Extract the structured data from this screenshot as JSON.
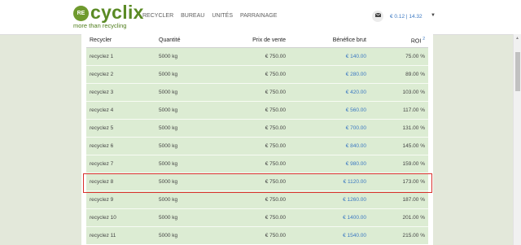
{
  "header": {
    "logo_badge": "RE",
    "logo_name": "cyclix",
    "logo_tagline": "more than recycling",
    "nav": [
      "RECYCLER",
      "BUREAU",
      "UNITÉS",
      "PARRAINAGE"
    ],
    "wallet_value": "€ 0.12 | 14.32"
  },
  "icons": {
    "messages": "envelope-icon",
    "account": "caret-down-icon"
  },
  "colors": {
    "brand_green": "#5a8a24",
    "row_bg": "#dcecd3",
    "link_blue": "#3b78c2",
    "highlight_red": "#d9312c"
  },
  "table": {
    "headers": [
      "Recycler",
      "Quantité",
      "Prix de vente",
      "Bénéfice brut",
      "ROI"
    ],
    "roi_note": "2",
    "rows": [
      [
        "recyclez 1",
        "5000 kg",
        "€ 750.00",
        "€ 140.00",
        "75.00 %"
      ],
      [
        "recyclez 2",
        "5000 kg",
        "€ 750.00",
        "€ 280.00",
        "89.00 %"
      ],
      [
        "recyclez 3",
        "5000 kg",
        "€ 750.00",
        "€ 420.00",
        "103.00 %"
      ],
      [
        "recyclez 4",
        "5000 kg",
        "€ 750.00",
        "€ 560.00",
        "117.00 %"
      ],
      [
        "recyclez 5",
        "5000 kg",
        "€ 750.00",
        "€ 700.00",
        "131.00 %"
      ],
      [
        "recyclez 6",
        "5000 kg",
        "€ 750.00",
        "€ 840.00",
        "145.00 %"
      ],
      [
        "recyclez 7",
        "5000 kg",
        "€ 750.00",
        "€ 980.00",
        "159.00 %"
      ],
      [
        "recyclez 8",
        "5000 kg",
        "€ 750.00",
        "€ 1120.00",
        "173.00 %"
      ],
      [
        "recyclez 9",
        "5000 kg",
        "€ 750.00",
        "€ 1260.00",
        "187.00 %"
      ],
      [
        "recyclez 10",
        "5000 kg",
        "€ 750.00",
        "€ 1400.00",
        "201.00 %"
      ],
      [
        "recyclez 11",
        "5000 kg",
        "€ 750.00",
        "€ 1540.00",
        "215.00 %"
      ]
    ]
  }
}
